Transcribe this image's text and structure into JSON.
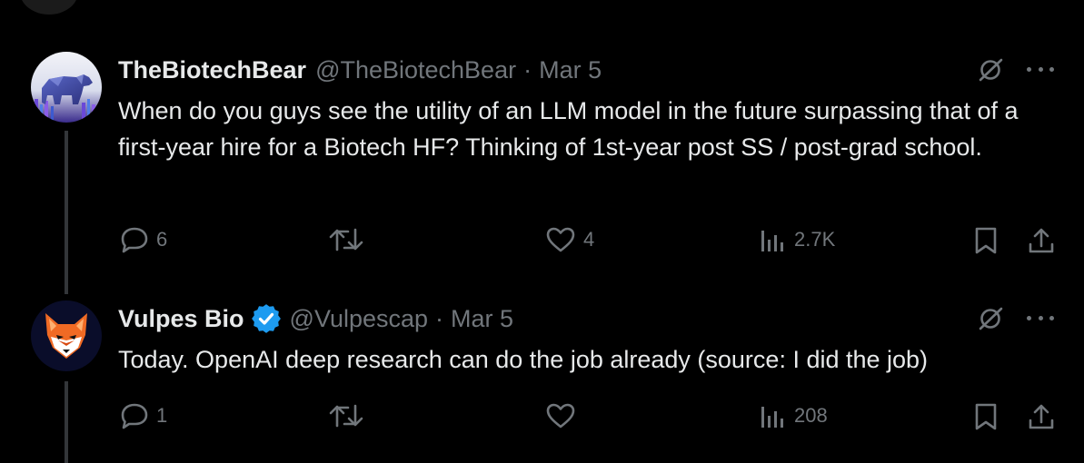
{
  "tweets": [
    {
      "display_name": "TheBiotechBear",
      "handle": "@TheBiotechBear",
      "separator": "·",
      "date": "Mar 5",
      "verified": false,
      "text": "When do you guys see the utility of an LLM model in the future surpassing that of a first-year hire for a Biotech HF? Thinking of 1st-year post SS / post-grad school.",
      "avatar_icon": "bear-avatar-icon",
      "actions": {
        "replies": "6",
        "reposts": "",
        "likes": "4",
        "views": "2.7K"
      }
    },
    {
      "display_name": "Vulpes Bio",
      "handle": "@Vulpescap",
      "separator": "·",
      "date": "Mar 5",
      "verified": true,
      "text": "Today. OpenAI deep research can do the job already (source: I did the job)",
      "avatar_icon": "fox-avatar-icon",
      "actions": {
        "replies": "1",
        "reposts": "",
        "likes": "",
        "views": "208"
      }
    }
  ],
  "colors": {
    "background": "#000000",
    "text": "#e7e9ea",
    "muted": "#71767b",
    "verified_blue": "#1d9bf0",
    "thread_line": "#333639"
  }
}
